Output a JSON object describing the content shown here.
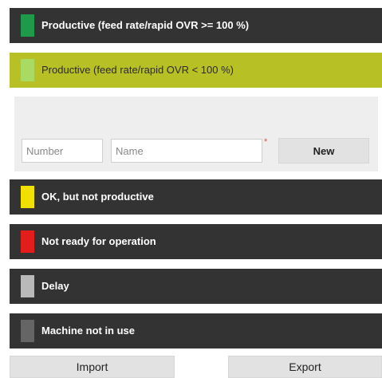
{
  "statuses": [
    {
      "label": "Productive (feed rate/rapid OVR >= 100 %)",
      "color": "#1e9a4a"
    },
    {
      "label": "Productive (feed rate/rapid OVR < 100 %)",
      "color": "#a9da63"
    },
    {
      "label": "OK, but not productive",
      "color": "#f2e000"
    },
    {
      "label": "Not ready for operation",
      "color": "#e31c1c"
    },
    {
      "label": "Delay",
      "color": "#b9b9b9"
    },
    {
      "label": "Machine not in use",
      "color": "#656565"
    }
  ],
  "form": {
    "number_placeholder": "Number",
    "name_placeholder": "Name",
    "required_mark": "*",
    "new_label": "New"
  },
  "footer": {
    "import_label": "Import",
    "export_label": "Export"
  }
}
